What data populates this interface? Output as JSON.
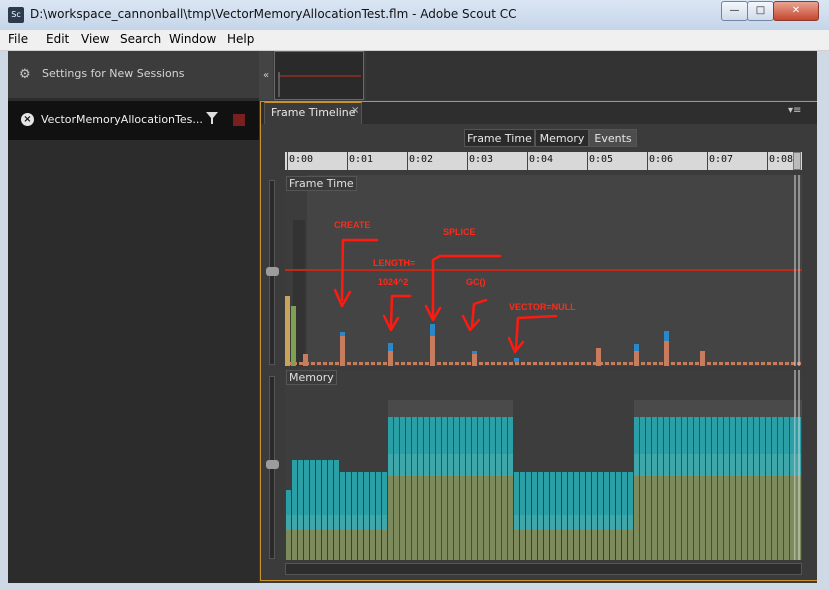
{
  "window": {
    "title": "D:\\workspace_cannonball\\tmp\\VectorMemoryAllocationTest.flm - Adobe Scout CC",
    "app_icon": "Sc",
    "minimize": "—",
    "maximize": "□",
    "close": "✕"
  },
  "menu": [
    "File",
    "Edit",
    "View",
    "Search",
    "Window",
    "Help"
  ],
  "sidebar": {
    "settings_label": "Settings for New Sessions",
    "session_label": "VectorMemoryAllocationTes..."
  },
  "panel": {
    "tab_label": "Frame Timeline",
    "tab_close": "×",
    "menu_icon": "▾≡",
    "collapse": "«",
    "segments": [
      "Frame Time",
      "Memory",
      "Events"
    ],
    "selected_segment": "Events"
  },
  "ruler": {
    "ticks": [
      "0:00",
      "0:01",
      "0:02",
      "0:03",
      "0:04",
      "0:05",
      "0:06",
      "0:07",
      "0:08"
    ]
  },
  "frame_time": {
    "label": "Frame Time"
  },
  "memory": {
    "label": "Memory"
  },
  "annotations": [
    "CREATE",
    "SPLICE",
    "LENGTH=",
    "1024^2",
    "GC()",
    "VECTOR=NULL"
  ],
  "colors": {
    "accent_border": "#c8932a",
    "annotation": "#ff2a1a",
    "frame_orange": "#c77c5e",
    "frame_blue": "#2a87c8",
    "mem_teal": "#2aa0a6",
    "mem_olive": "#7c8a5c"
  }
}
